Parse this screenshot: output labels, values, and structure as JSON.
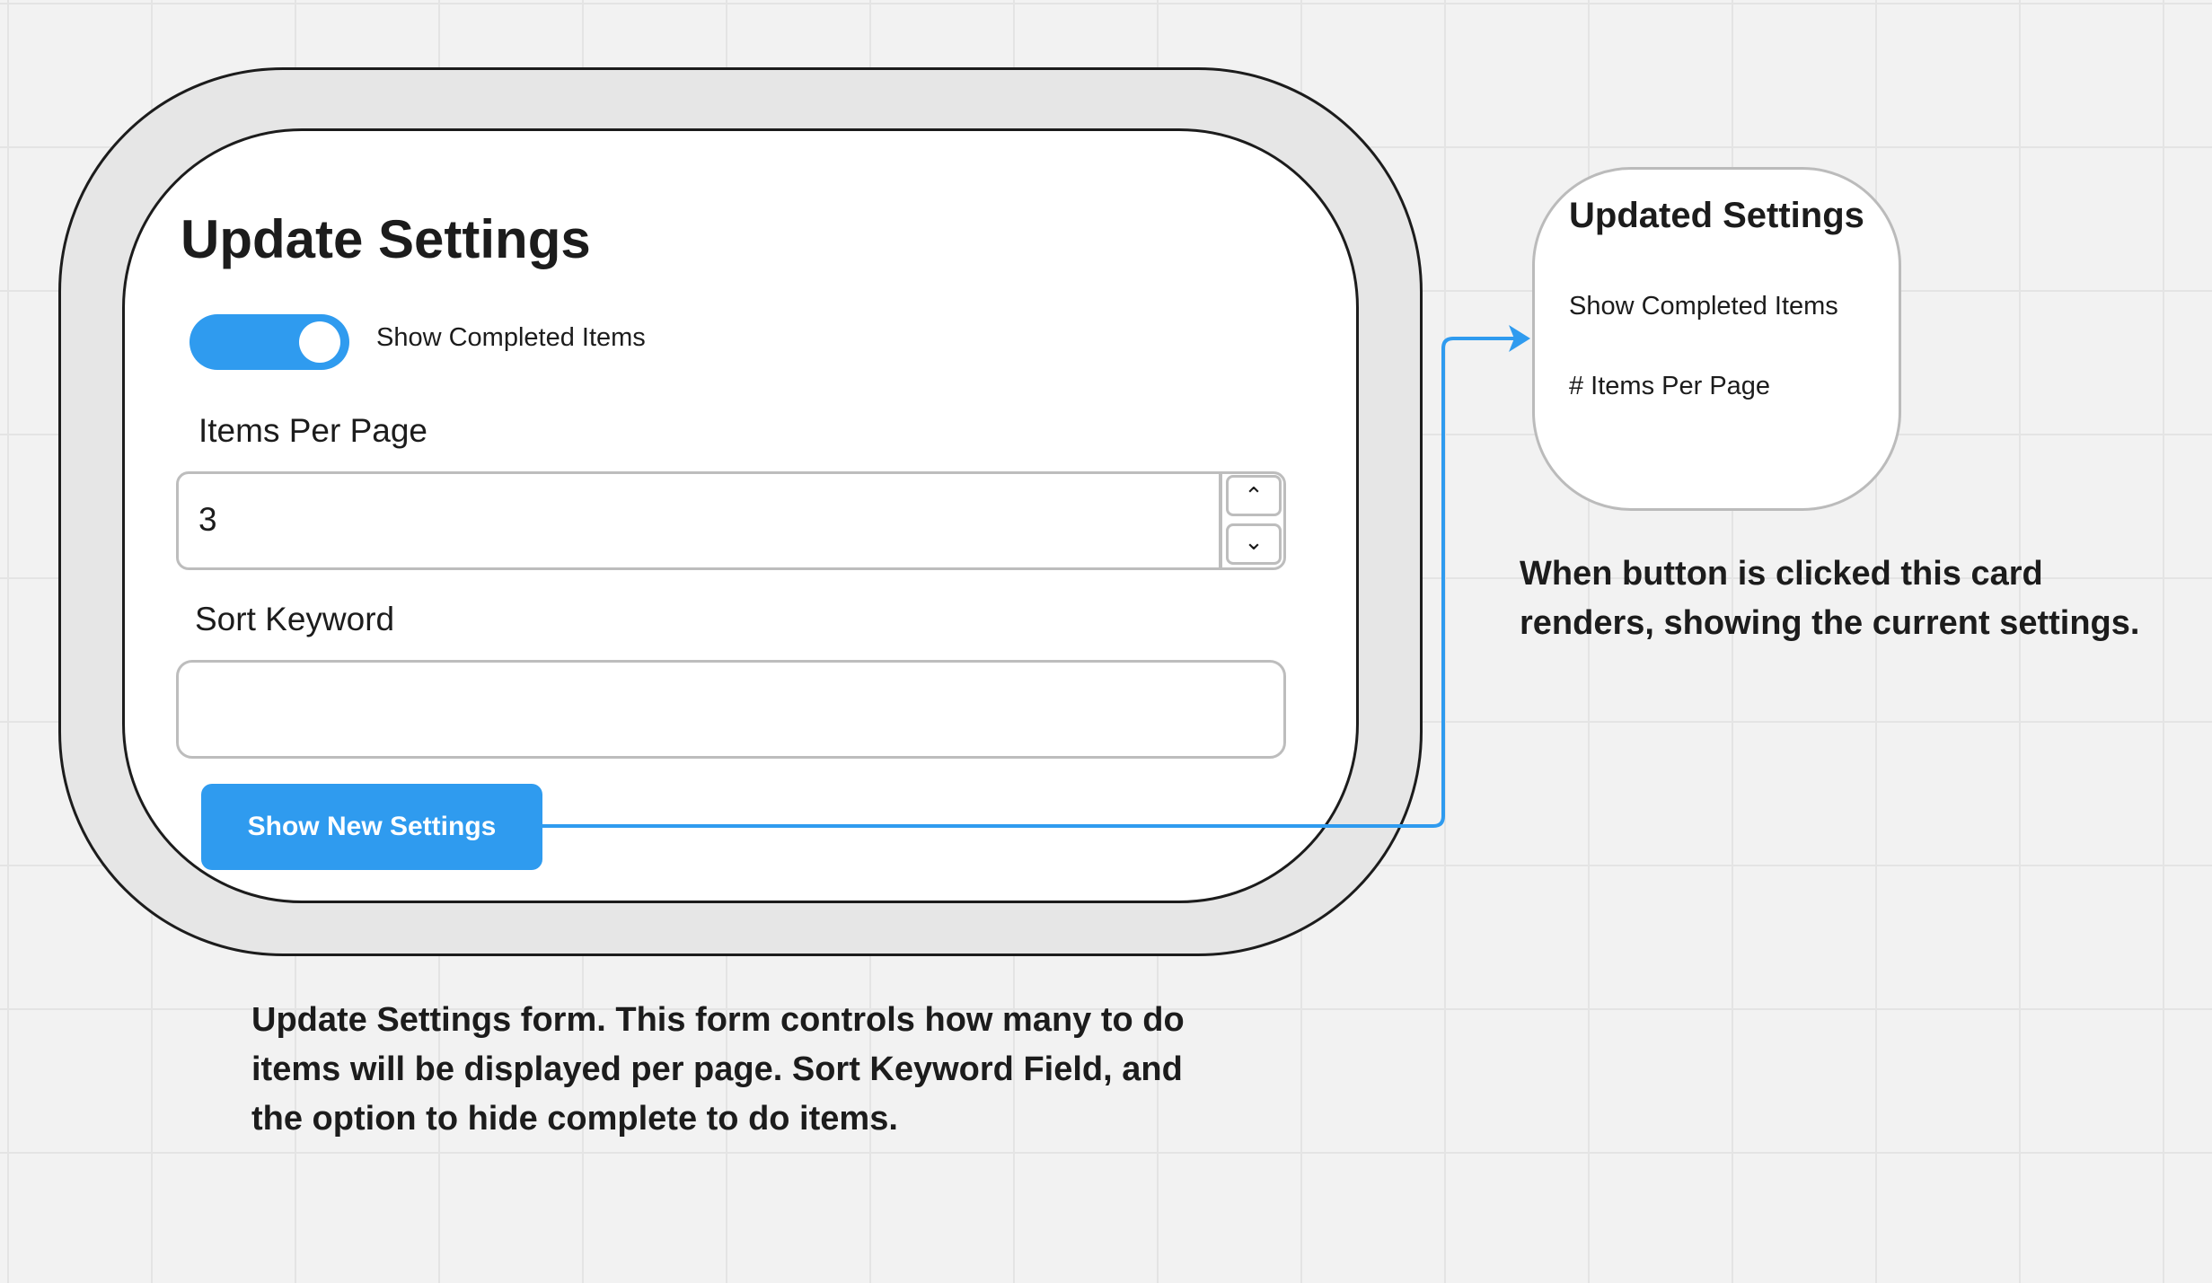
{
  "form": {
    "title": "Update Settings",
    "toggle_label": "Show Completed Items",
    "toggle_on": true,
    "items_per_page_label": "Items Per Page",
    "items_per_page_value": "3",
    "sort_keyword_label": "Sort Keyword",
    "sort_keyword_value": "",
    "button_label": "Show New Settings"
  },
  "result_card": {
    "title": "Updated Settings",
    "line1": "Show Completed Items",
    "line2": "# Items Per Page"
  },
  "notes": {
    "right": "When button is clicked this card renders, showing the current settings.",
    "bottom": "Update Settings form. This form controls how many to do items will be displayed per page. Sort Keyword Field, and the option to hide complete to do items."
  },
  "colors": {
    "accent": "#2f9bef"
  }
}
